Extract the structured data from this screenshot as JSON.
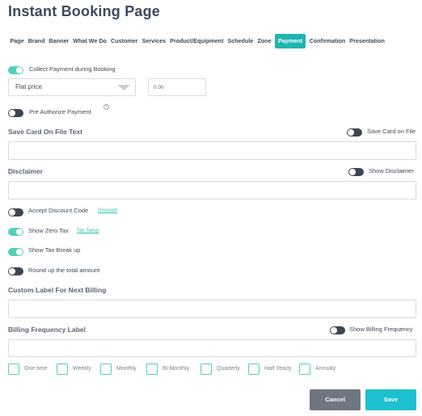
{
  "page": {
    "title": "Instant Booking Page"
  },
  "tabs": [
    {
      "label": "Page"
    },
    {
      "label": "Brand"
    },
    {
      "label": "Banner"
    },
    {
      "label": "What We Do"
    },
    {
      "label": "Customer"
    },
    {
      "label": "Services"
    },
    {
      "label": "Product/Equipment"
    },
    {
      "label": "Schedule"
    },
    {
      "label": "Zone"
    },
    {
      "label": "Payment",
      "active": true
    },
    {
      "label": "Confirmation"
    },
    {
      "label": "Presentation"
    }
  ],
  "payment": {
    "collect_label": "Collect Payment during Booking",
    "collect_on": true,
    "price_type": "Flat price",
    "amount_placeholder": "0.00",
    "preauth_label": "Pre Authorize Payment",
    "preauth_on": false,
    "info_icon": "i"
  },
  "save_card": {
    "heading": "Save Card On File Text",
    "toggle_label": "Save Card on File",
    "on": false
  },
  "disclaimer": {
    "heading": "Disclaimer",
    "toggle_label": "Show Disclaimer",
    "on": false
  },
  "options": {
    "discount_label": "Accept Discount Code",
    "discount_link": "Discount",
    "discount_on": false,
    "zero_tax_label": "Show Zero Tax",
    "tax_setup_link": "Tax Setup",
    "zero_tax_on": true,
    "tax_breakup_label": "Show Tax Break up",
    "tax_breakup_on": true,
    "round_label": "Round up the total amount",
    "round_on": false
  },
  "next_billing": {
    "heading": "Custom Label For Next Billing"
  },
  "billing_frequency": {
    "heading": "Billing Frequency Label",
    "toggle_label": "Show Billing Frequency",
    "on": false,
    "choices": [
      "One time",
      "Weekly",
      "Monthly",
      "Bi-Monthly",
      "Quarterly",
      "Half Yearly",
      "Annualy"
    ]
  },
  "actions": {
    "cancel_label": "Cancel",
    "save_label": "Save"
  },
  "colors": {
    "accent": "#1fb5ad",
    "toggle_on": "#55d0b8",
    "toggle_off": "#3e4552",
    "save": "#1ec0cf",
    "cancel": "#6e7682"
  }
}
